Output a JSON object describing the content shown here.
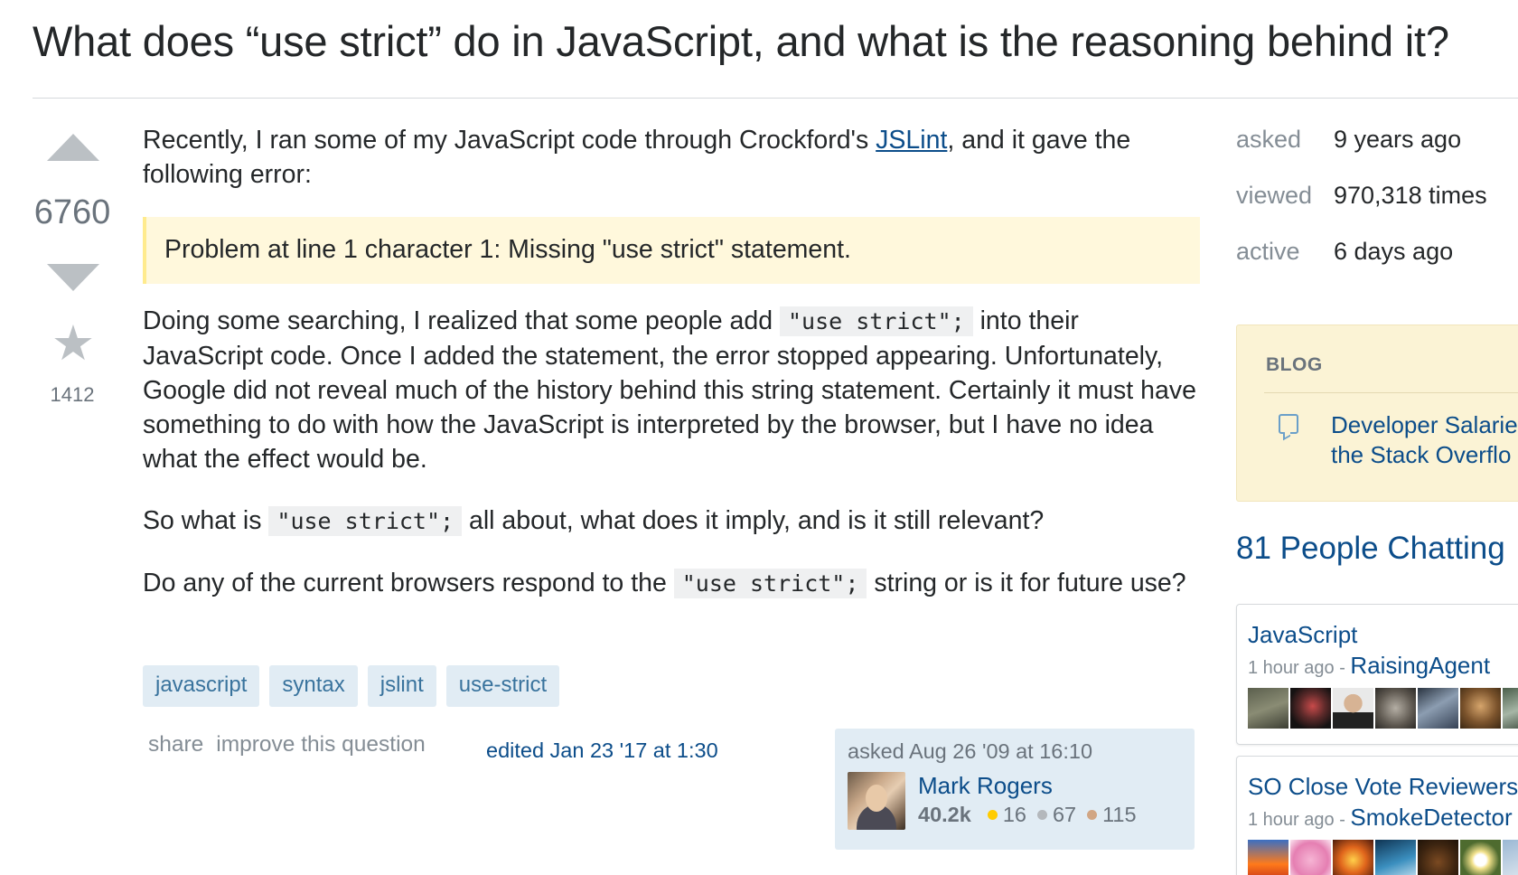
{
  "question": {
    "title": "What does “use strict” do in JavaScript, and what is the reasoning behind it?",
    "votes": "6760",
    "favorites": "1412",
    "body": {
      "p1_before": "Recently, I ran some of my JavaScript code through Crockford's ",
      "p1_link": "JSLint",
      "p1_after": ", and it gave the following error:",
      "quote": "Problem at line 1 character 1: Missing \"use strict\" statement.",
      "p2_before": "Doing some searching, I realized that some people add ",
      "p2_code": "\"use strict\";",
      "p2_after": " into their JavaScript code. Once I added the statement, the error stopped appearing. Unfortunately, Google did not reveal much of the history behind this string statement. Certainly it must have something to do with how the JavaScript is interpreted by the browser, but I have no idea what the effect would be.",
      "p3_before": "So what is ",
      "p3_code": "\"use strict\";",
      "p3_after": " all about, what does it imply, and is it still relevant?",
      "p4_before": "Do any of the current browsers respond to the ",
      "p4_code": "\"use strict\";",
      "p4_after": " string or is it for future use?"
    },
    "tags": [
      "javascript",
      "syntax",
      "jslint",
      "use-strict"
    ],
    "menu": {
      "share": "share",
      "improve": "improve this question"
    },
    "edited": "edited Jan 23 '17 at 1:30",
    "asker": {
      "asked": "asked Aug 26 '09 at 16:10",
      "name": "Mark Rogers",
      "reputation": "40.2k",
      "gold": "16",
      "silver": "67",
      "bronze": "115"
    }
  },
  "sidebar": {
    "meta": [
      {
        "label": "asked",
        "value": "9 years ago"
      },
      {
        "label": "viewed",
        "value": "970,318 times"
      },
      {
        "label": "active",
        "value": "6 days ago"
      }
    ],
    "blog": {
      "heading": "BLOG",
      "line1": "Developer Salarie",
      "line2": "the Stack Overflo"
    },
    "chat": {
      "heading": "81 People Chatting",
      "rooms": [
        {
          "name": "JavaScript",
          "ago": "1 hour ago - ",
          "user": "RaisingAgent"
        },
        {
          "name": "SO Close Vote Reviewers",
          "ago": "1 hour ago - ",
          "user": "SmokeDetector"
        }
      ]
    }
  },
  "colors": {
    "link": "#0c4d8a",
    "tag_bg": "#e1ecf4",
    "tag_text": "#39739d",
    "quote_bg": "#fff8dc",
    "blog_bg": "#fbf3d5",
    "muted": "#848d95"
  }
}
